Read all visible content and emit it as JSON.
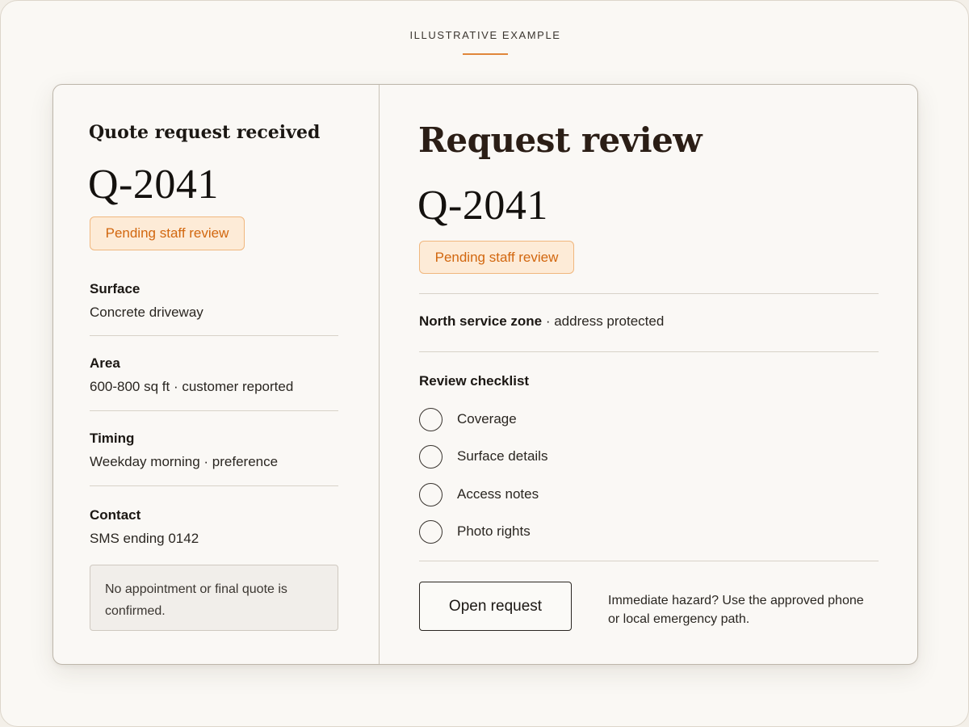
{
  "eyebrow": "ILLUSTRATIVE EXAMPLE",
  "colors": {
    "accent": "#e0863a",
    "badge_text": "#d2670f",
    "badge_bg": "#fdebd7",
    "badge_border": "#f0b77e"
  },
  "left_panel": {
    "title": "Quote request received",
    "request_id": "Q-2041",
    "status_badge": "Pending staff review",
    "fields": [
      {
        "label": "Surface",
        "value": "Concrete driveway"
      },
      {
        "label": "Area",
        "value": "600-800 sq ft · customer reported"
      },
      {
        "label": "Timing",
        "value": "Weekday morning · preference"
      },
      {
        "label": "Contact",
        "value": "SMS ending 0142"
      }
    ],
    "notice": "No appointment or final quote is confirmed."
  },
  "right_panel": {
    "title": "Request review",
    "request_id": "Q-2041",
    "status_badge": "Pending staff review",
    "zone_label": "North service zone",
    "zone_separator": " · ",
    "zone_detail": "address protected",
    "checklist_title": "Review checklist",
    "checklist": [
      {
        "label": "Coverage",
        "checked": false
      },
      {
        "label": "Surface details",
        "checked": false
      },
      {
        "label": "Access notes",
        "checked": false
      },
      {
        "label": "Photo rights",
        "checked": false
      }
    ],
    "open_button": "Open request",
    "hazard_note": "Immediate hazard? Use the approved phone or local emergency path."
  }
}
